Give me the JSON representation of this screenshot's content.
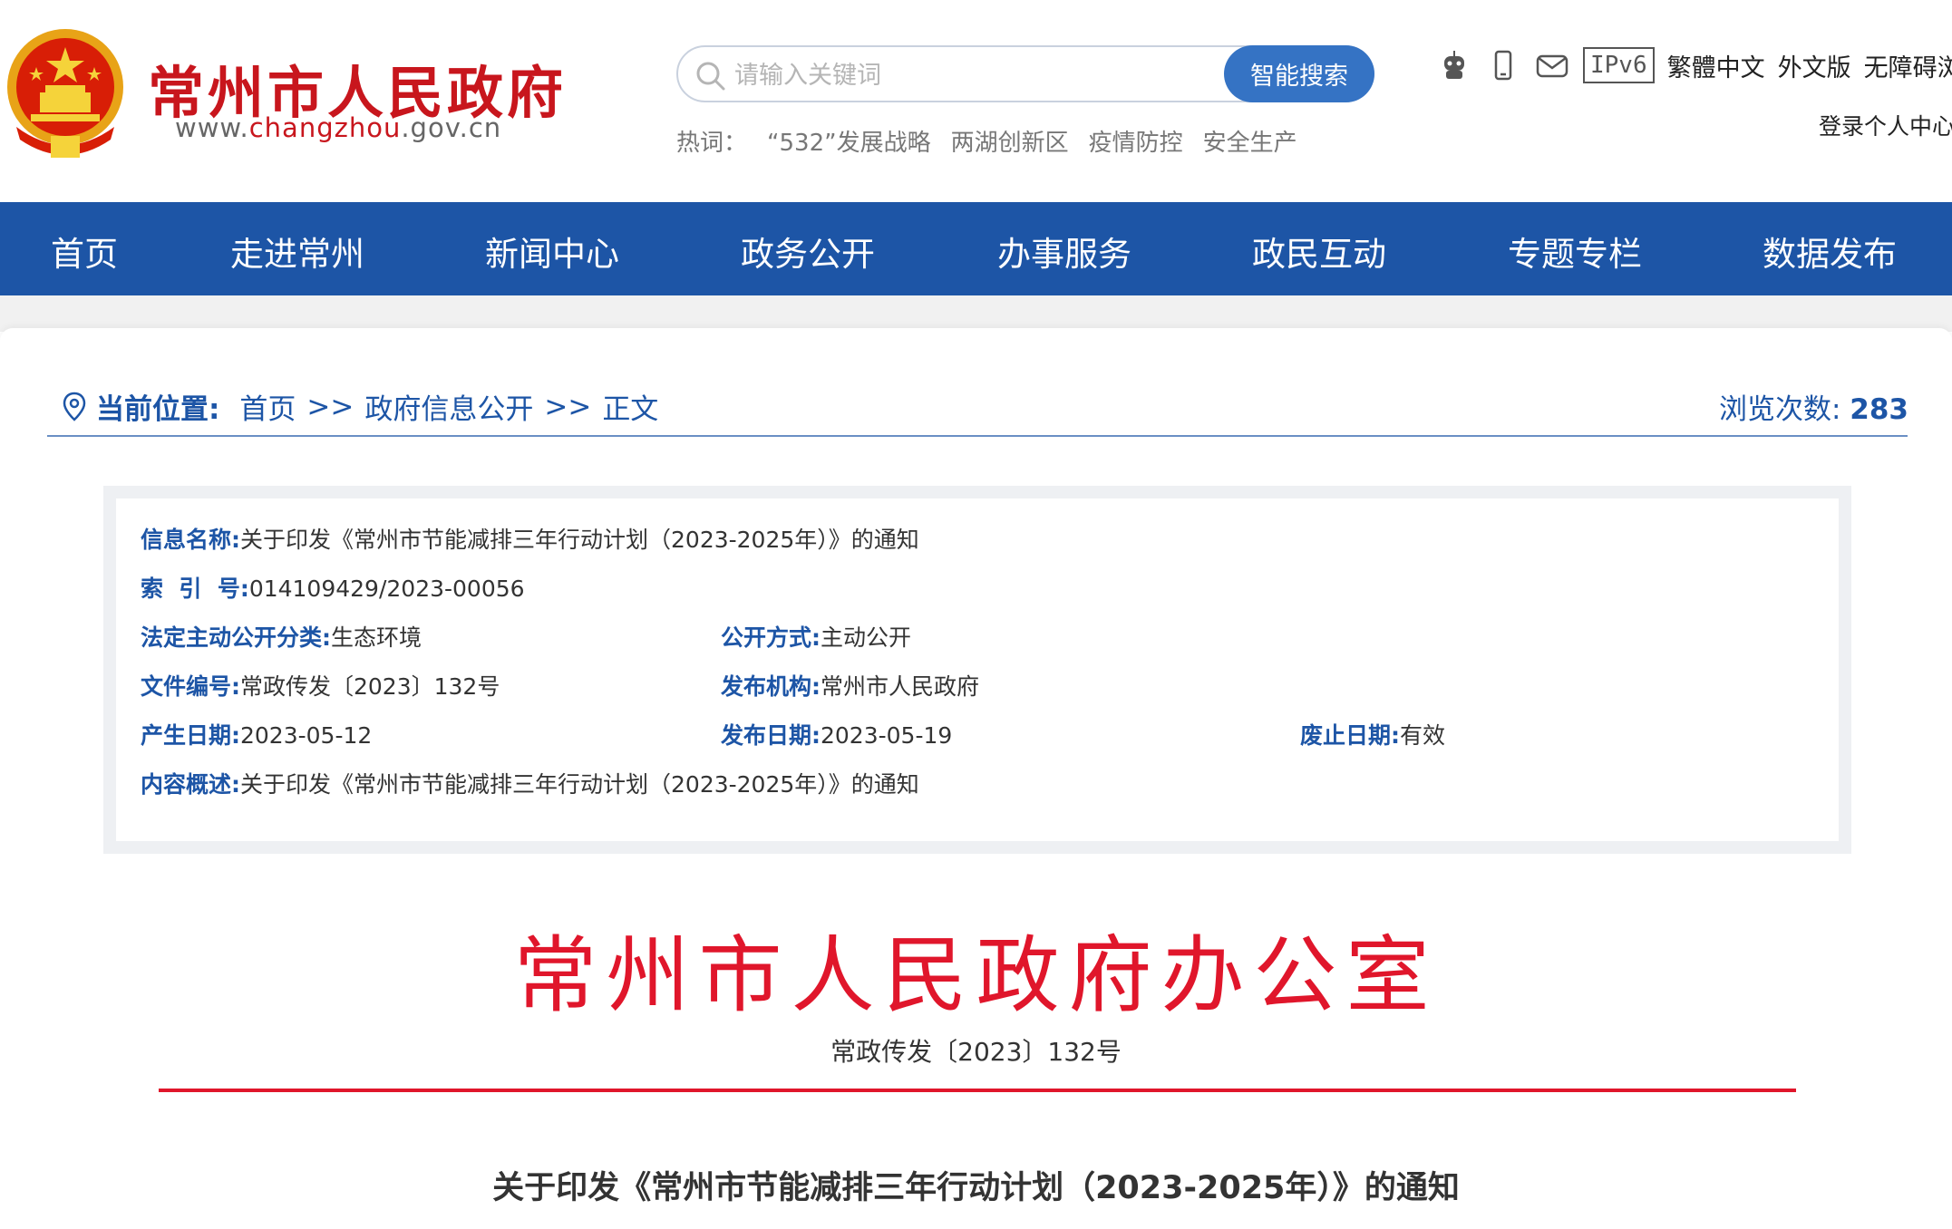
{
  "header": {
    "site_title": "常州市人民政府",
    "site_url_prefix": "www.",
    "site_url_highlight": "changzhou",
    "site_url_suffix": ".gov.cn",
    "search_placeholder": "请输入关键词",
    "search_button": "智能搜索",
    "hotwords_label": "热词：",
    "hotwords": [
      "“532”发展战略",
      "两湖创新区",
      "疫情防控",
      "安全生产"
    ],
    "ipv6": "IPv6",
    "tools": [
      "繁體中文",
      "外文版",
      "无障碍浏览"
    ],
    "user_links": "登录个人中心"
  },
  "nav": {
    "items": [
      "首页",
      "走进常州",
      "新闻中心",
      "政务公开",
      "办事服务",
      "政民互动",
      "专题专栏",
      "数据发布"
    ]
  },
  "breadcrumb": {
    "label": "当前位置:",
    "items": [
      "首页",
      "政府信息公开",
      "正文"
    ],
    "separator": ">>",
    "views_label": "浏览次数:",
    "views_count": "283"
  },
  "info": {
    "name_k": "信息名称:",
    "name_v": "关于印发《常州市节能减排三年行动计划（2023-2025年）》的通知",
    "index_k": "索  引  号:",
    "index_v": "014109429/2023-00056",
    "category_k": "法定主动公开分类:",
    "category_v": "生态环境",
    "method_k": "公开方式:",
    "method_v": "主动公开",
    "docno_k": "文件编号:",
    "docno_v": "常政传发〔2023〕132号",
    "publisher_k": "发布机构:",
    "publisher_v": "常州市人民政府",
    "created_k": "产生日期:",
    "created_v": "2023-05-12",
    "published_k": "发布日期:",
    "published_v": "2023-05-19",
    "expire_k": "废止日期:",
    "expire_v": "有效",
    "summary_k": "内容概述:",
    "summary_v": "关于印发《常州市节能减排三年行动计划（2023-2025年）》的通知"
  },
  "document": {
    "org": "常州市人民政府办公室",
    "doc_no": "常政传发〔2023〕132号",
    "title": "关于印发《常州市节能减排三年行动计划（2023-2025年）》的通知"
  },
  "colors": {
    "brand_blue": "#1d55a6",
    "brand_red": "#c8161d",
    "doc_red": "#e0162b"
  }
}
